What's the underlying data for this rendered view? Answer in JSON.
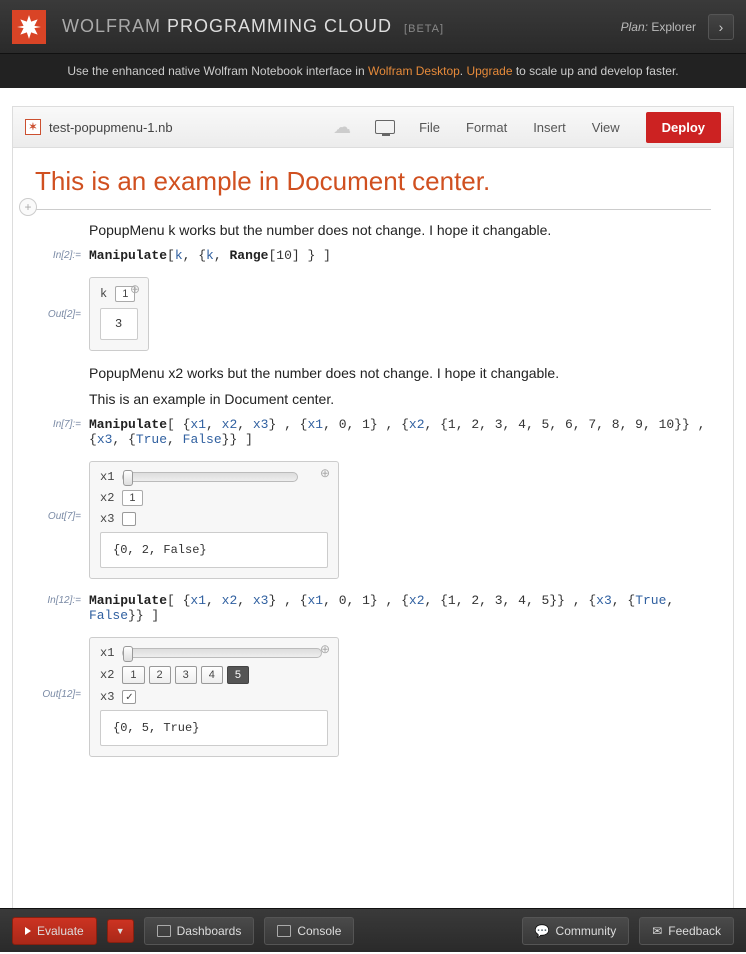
{
  "header": {
    "brand1": "WOLFRAM",
    "brand2": "PROGRAMMING CLOUD",
    "beta": "[BETA]",
    "plan_label": "Plan:",
    "plan_value": "Explorer",
    "expand_glyph": "›"
  },
  "promo": {
    "t1": "Use the enhanced native Wolfram Notebook interface in ",
    "link1": "Wolfram Desktop",
    "t2": ". ",
    "link2": "Upgrade",
    "t3": " to scale up and develop faster."
  },
  "toolbar": {
    "filename": "test-popupmenu-1.nb",
    "menu_file": "File",
    "menu_format": "Format",
    "menu_insert": "Insert",
    "menu_view": "View",
    "deploy": "Deploy"
  },
  "notebook": {
    "title": "This is an example in Document center.",
    "text1": "PopupMenu k works but the number does not change. I hope it changable.",
    "in2_label": "In[2]:=",
    "in2_code_fn": "Manipulate",
    "in2_code_rest": "[k, {k, Range[10] } ]",
    "out2_label": "Out[2]=",
    "manip1": {
      "k_label": "k",
      "k_value": "1",
      "result": "3"
    },
    "text2": "PopupMenu x2 works but the number does not change. I hope it changable.",
    "text3": "This is an example in Document center.",
    "in7_label": "In[7]:=",
    "in7_code": "Manipulate[ {x1, x2, x3} , {x1, 0, 1} , {x2, {1, 2, 3, 4, 5, 6, 7, 8, 9, 10}} , {x3, {True, False}} ]",
    "out7_label": "Out[7]=",
    "manip2": {
      "x1_label": "x1",
      "x1_val": 0,
      "x2_label": "x2",
      "x2_value": "1",
      "x3_label": "x3",
      "x3_checked": false,
      "result": "{0, 2, False}"
    },
    "in12_label": "In[12]:=",
    "in12_code": "Manipulate[ {x1, x2, x3} , {x1, 0, 1} , {x2, {1, 2, 3, 4, 5}} , {x3, {True, False}} ]",
    "out12_label": "Out[12]=",
    "manip3": {
      "x1_label": "x1",
      "x1_val": 0,
      "x2_label": "x2",
      "x2_options": [
        "1",
        "2",
        "3",
        "4",
        "5"
      ],
      "x2_active": 4,
      "x3_label": "x3",
      "x3_checked": true,
      "result": "{0, 5, True}"
    }
  },
  "bottombar": {
    "evaluate": "Evaluate",
    "dashboards": "Dashboards",
    "console": "Console",
    "community": "Community",
    "feedback": "Feedback"
  }
}
